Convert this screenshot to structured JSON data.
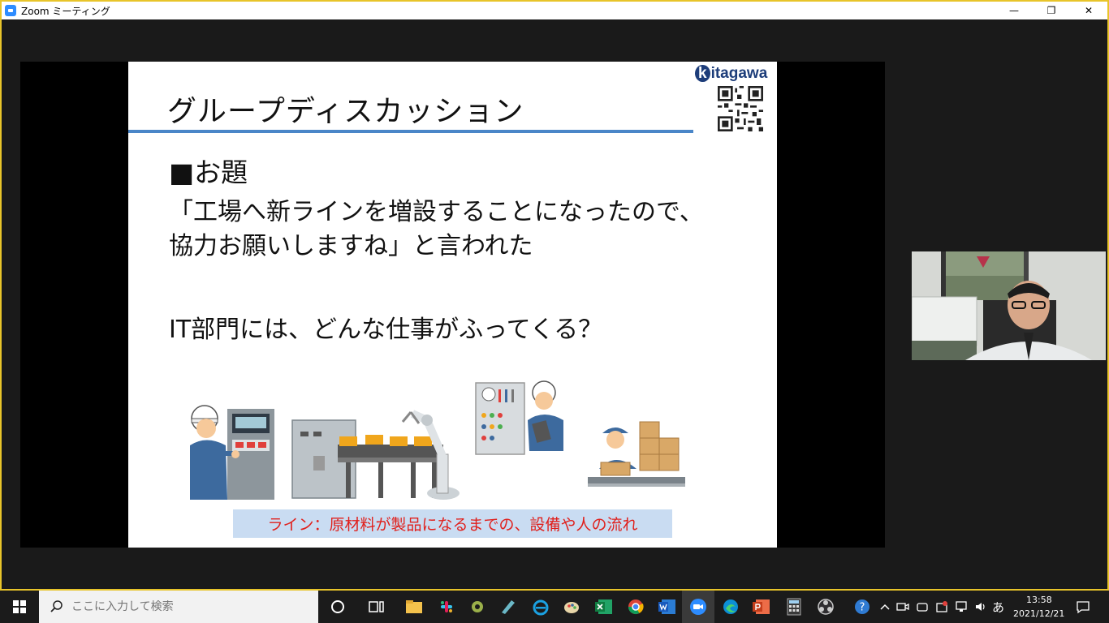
{
  "window": {
    "title": "Zoom ミーティング",
    "minimize": "—",
    "restore": "❐",
    "close": "✕"
  },
  "slide": {
    "title": "グループディスカッション",
    "logo_k": "k",
    "logo_rest": "itagawa",
    "topic": "■お題",
    "quote_line1": "「工場へ新ラインを増設することになったので、",
    "quote_line2": "協力お願いしますね」と言われた",
    "question": "IT部門には、どんな仕事がふってくる？",
    "caption": "ライン：原材料が製品になるまでの、設備や人の流れ"
  },
  "taskbar": {
    "search_placeholder": "ここに入力して検索",
    "ime": "あ",
    "time": "13:58",
    "date": "2021/12/21"
  },
  "colors": {
    "accent_border": "#e8c42a",
    "title_rule": "#4a86c8",
    "caption_bg": "#c9dcf2",
    "caption_text": "#e0201c"
  }
}
